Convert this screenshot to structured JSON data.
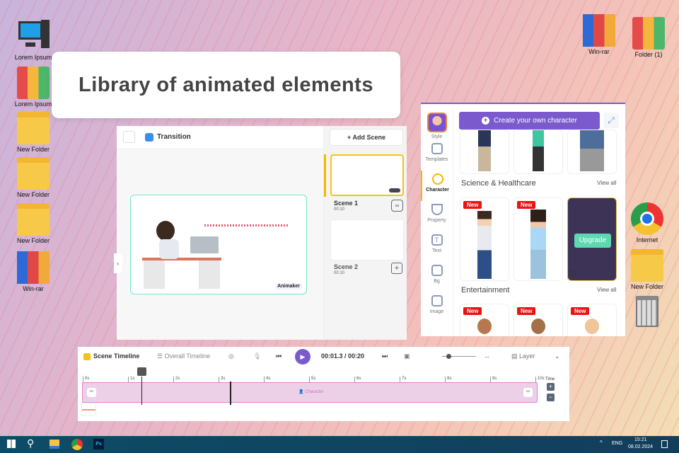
{
  "desktop": {
    "left_icons": [
      {
        "label": "Lorem Ipsum",
        "icon": "computer-icon"
      },
      {
        "label": "Lorem Ipsum",
        "icon": "binders-icon"
      },
      {
        "label": "New Folder",
        "icon": "folder-icon"
      },
      {
        "label": "New Folder",
        "icon": "folder-icon"
      },
      {
        "label": "New Folder",
        "icon": "folder-icon"
      },
      {
        "label": "Win-rar",
        "icon": "winrar-icon"
      }
    ],
    "right_icons": [
      {
        "label": "Win-rar",
        "icon": "winrar-icon"
      },
      {
        "label": "Folder (1)",
        "icon": "binders-icon"
      },
      {
        "label": "Internet",
        "icon": "chrome-icon"
      },
      {
        "label": "New Folder",
        "icon": "folder-icon"
      },
      {
        "label": "",
        "icon": "trash-icon"
      }
    ]
  },
  "banner": {
    "title": "Library of animated elements"
  },
  "editor": {
    "transition_label": "Transition",
    "add_scene": "+ Add Scene",
    "scenes": [
      {
        "name": "Scene 1",
        "duration": "00:10"
      },
      {
        "name": "Scene 2",
        "duration": "00:10"
      }
    ],
    "watermark": "Animaker"
  },
  "characters": {
    "create_button": "Create your own character",
    "sidebar": [
      "Style",
      "Templates",
      "Character",
      "Property",
      "Text",
      "Bg",
      "Image"
    ],
    "sections": [
      {
        "title": "Science & Healthcare",
        "view_all": "View all",
        "badge": "New",
        "upgrade": "Upgrade"
      },
      {
        "title": "Entertainment",
        "view_all": "View all",
        "badge": "New"
      }
    ]
  },
  "timeline": {
    "scene_timeline": "Scene Timeline",
    "overall_timeline": "Overall Timeline",
    "current": "00:01.3",
    "total": "00:20",
    "separator": " / ",
    "layer": "Layer",
    "ticks": [
      "0s",
      "1s",
      "2s",
      "3s",
      "4s",
      "5s",
      "6s",
      "7s",
      "8s",
      "9s",
      "10s"
    ],
    "track_label": "Character",
    "time_label": "Time",
    "progress_fraction": 0.13
  },
  "taskbar": {
    "lang": "ENG",
    "time": "15:21",
    "date": "08.02.2024"
  }
}
